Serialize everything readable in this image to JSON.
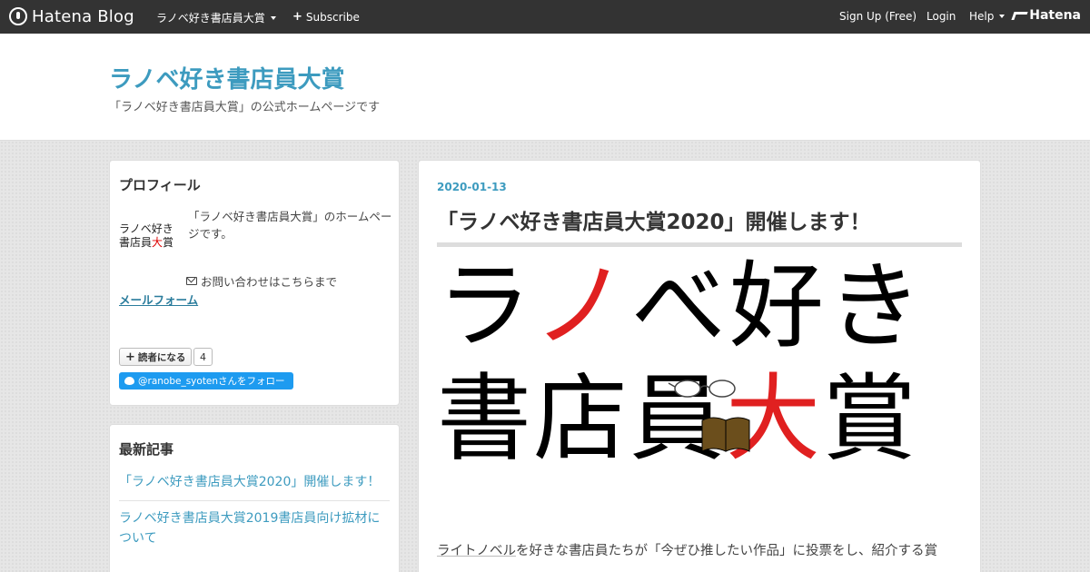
{
  "topbar": {
    "logo_text": "Hatena Blog",
    "blog_menu": "ラノベ好き書店員大賞",
    "subscribe": "Subscribe",
    "signup": "Sign Up (Free)",
    "login": "Login",
    "help": "Help",
    "hatena": "Hatena"
  },
  "header": {
    "title": "ラノベ好き書店員大賞",
    "description": "「ラノベ好き書店員大賞」の公式ホームページです"
  },
  "profile": {
    "heading": "プロフィール",
    "icon_line1": "ラノベ好き",
    "icon_line2a": "書店員",
    "icon_line2b": "大",
    "icon_line2c": "賞",
    "text": "「ラノベ好き書店員大賞」のホームページです。",
    "contact": "お問い合わせはこちらまで",
    "mail_link": "メールフォーム",
    "reader_button": "読者になる",
    "reader_count": "4",
    "twitter_follow": "@ranobe_syotenさんをフォロー"
  },
  "recent": {
    "heading": "最新記事",
    "items": [
      "「ラノベ好き書店員大賞2020」開催します！",
      "ラノベ好き書店員大賞2019書店員向け拡材について"
    ]
  },
  "entry": {
    "date": "2020-01-13",
    "title": "「ラノベ好き書店員大賞2020」開催します！",
    "banner_line1_a": "ラ",
    "banner_line1_b": "ノ",
    "banner_line1_c": "べ好き",
    "banner_line2_a": "書店員",
    "banner_line2_b": "大",
    "banner_line2_c": "賞",
    "body_link": "ライトノベル",
    "body_text": "を好きな書店員たちが「今ぜひ推したい作品」に投票をし、紹介する賞"
  },
  "colors": {
    "accent": "#3d9bbf",
    "topbar": "#333333",
    "banner_red": "#e02020",
    "twitter": "#1d9bf0"
  }
}
